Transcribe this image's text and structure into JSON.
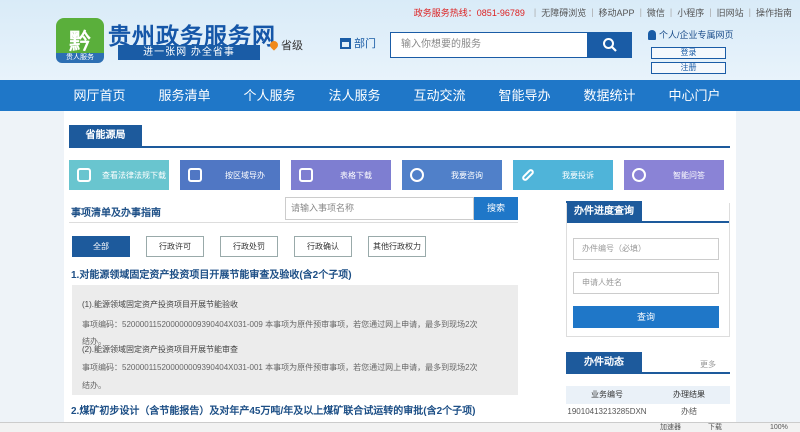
{
  "header": {
    "hotline": "政务服务热线：0851-96789",
    "top_links": [
      "无障碍浏览",
      "移动APP",
      "微信",
      "小程序",
      "旧网站",
      "操作指南"
    ],
    "logo_text": "黔",
    "logo_sub": "贵人服务",
    "site_title": "贵州政务服务网",
    "slogan": "进一张网  办全省事",
    "province": "省级",
    "dept": "部门",
    "search_placeholder": "输入你想要的服务",
    "user_label": "个人/企业专属网页",
    "login": "登录",
    "register": "注册"
  },
  "nav": [
    "网厅首页",
    "服务清单",
    "个人服务",
    "法人服务",
    "互动交流",
    "智能导办",
    "数据统计",
    "中心门户"
  ],
  "section": {
    "title": "省能源局"
  },
  "quick_links": [
    {
      "label": "查看法律法规下载",
      "icon": "scale-icon",
      "color": "#69c5cf"
    },
    {
      "label": "按区域导办",
      "icon": "bus-icon",
      "color": "#5077c4"
    },
    {
      "label": "表格下载",
      "icon": "table-icon",
      "color": "#7e7ed1"
    },
    {
      "label": "我要咨询",
      "icon": "headset-icon",
      "color": "#5080c9"
    },
    {
      "label": "我要投诉",
      "icon": "pencil-icon",
      "color": "#4fb4d9"
    },
    {
      "label": "智能问答",
      "icon": "bulb-icon",
      "color": "#8a83d6"
    }
  ],
  "list": {
    "title": "事项清单及办事指南",
    "search_placeholder": "请输入事项名称",
    "search_button": "搜索",
    "tabs": [
      "全部",
      "行政许可",
      "行政处罚",
      "行政确认",
      "其他行政权力"
    ],
    "items": [
      {
        "title": "1.对能源领域固定资产投资项目开展节能审查及验收(含2个子项)",
        "subs": [
          {
            "name": "(1).能源领域固定资产投资项目开展节能验收",
            "code": "事项编码：520000115200000009390404X031-009 本事项为原件预审事项，若您通过网上申请，最多到现场2次",
            "tail": "结办。"
          },
          {
            "name": "(2).能源领域固定资产投资项目开展节能审查",
            "code": "事项编码：520000115200000009390404X031-001 本事项为原件预审事项，若您通过网上申请，最多到现场2次",
            "tail": "结办。"
          }
        ]
      },
      {
        "title": "2.煤矿初步设计（含节能报告）及对年产45万吨/年及以上煤矿联合试运转的审批(含2个子项)"
      }
    ]
  },
  "progress": {
    "title": "办件进度查询",
    "code_placeholder": "办件编号（必填）",
    "name_placeholder": "申请人姓名",
    "button": "查询"
  },
  "dynamics": {
    "title": "办件动态",
    "more": "更多",
    "headers": [
      "业务编号",
      "办理结果"
    ],
    "rows": [
      [
        "19010413213285DXN",
        "办结"
      ]
    ]
  },
  "statusbar": {
    "left": "",
    "items": [
      "加速器",
      "下载",
      "100%"
    ]
  }
}
